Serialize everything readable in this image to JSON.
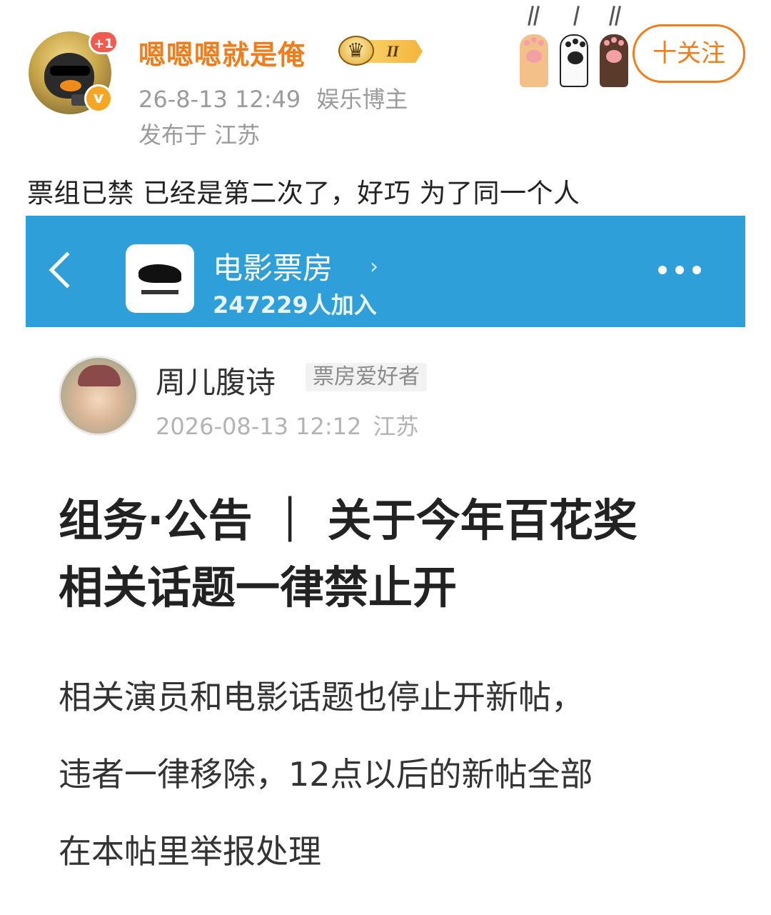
{
  "post": {
    "username": "嗯嗯嗯就是俺",
    "plus_badge": "+1",
    "v_badge": "v",
    "vip_level": "II",
    "time": "26-8-13 12:49",
    "role": "娱乐博主",
    "location": "发布于 江苏",
    "follow_label": "十关注",
    "text": "票组已禁 已经是第二次了，好巧 为了同一个人"
  },
  "screenshot": {
    "header": {
      "group_name": "电影票房",
      "chevron": "›",
      "member_count": "247229人加入"
    },
    "author": {
      "name": "周儿腹诗",
      "tag": "票房爱好者",
      "datetime": "2026-08-13 12:12",
      "location": "江苏"
    },
    "title_line1": "组务·公告 ｜ 关于今年百花奖",
    "title_line2": "相关话题一律禁止开",
    "body_line1": "相关演员和电影话题也停止开新帖，",
    "body_line2": "违者一律移除，12点以后的新帖全部",
    "body_line3": "在本帖里举报处理"
  },
  "colors": {
    "accent": "#f07d1c",
    "header_blue": "#2e9fd8",
    "meta_gray": "#9b9b9b"
  },
  "icons": [
    "avatar",
    "plus-badge",
    "verified-v-icon",
    "vip-crown-icon",
    "cat-paws-decoration",
    "back-chevron-icon",
    "group-logo",
    "chevron-right-icon",
    "more-icon"
  ]
}
